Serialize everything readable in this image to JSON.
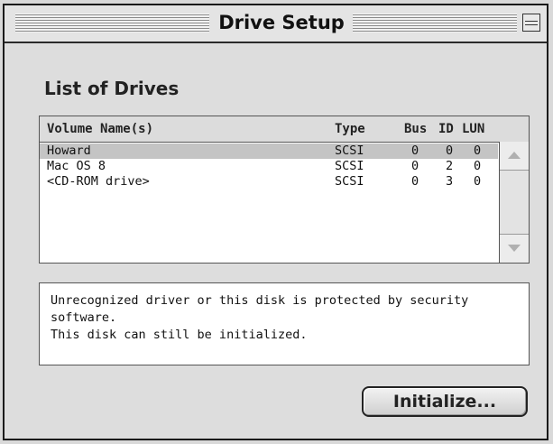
{
  "window": {
    "title": "Drive Setup"
  },
  "heading": "List of Drives",
  "list": {
    "columns": {
      "name": "Volume Name(s)",
      "type": "Type",
      "bus": "Bus",
      "id": "ID",
      "lun": "LUN"
    },
    "rows": [
      {
        "name": "Howard",
        "type": "SCSI",
        "bus": "0",
        "id": "0",
        "lun": "0",
        "selected": true
      },
      {
        "name": "Mac OS 8",
        "type": "SCSI",
        "bus": "0",
        "id": "2",
        "lun": "0",
        "selected": false
      },
      {
        "name": "<CD-ROM drive>",
        "type": "SCSI",
        "bus": "0",
        "id": "3",
        "lun": "0",
        "selected": false
      }
    ]
  },
  "message": {
    "line1": "Unrecognized driver or this disk is protected by security",
    "line2": "software.",
    "line3": "This disk can still be initialized."
  },
  "buttons": {
    "initialize": "Initialize..."
  },
  "icons": {
    "collapse": "collapse-box-icon",
    "scroll_up": "scroll-up-arrow-icon",
    "scroll_down": "scroll-down-arrow-icon"
  },
  "colors": {
    "selection": "#c4c4c4",
    "window_bg": "#dddddd"
  }
}
